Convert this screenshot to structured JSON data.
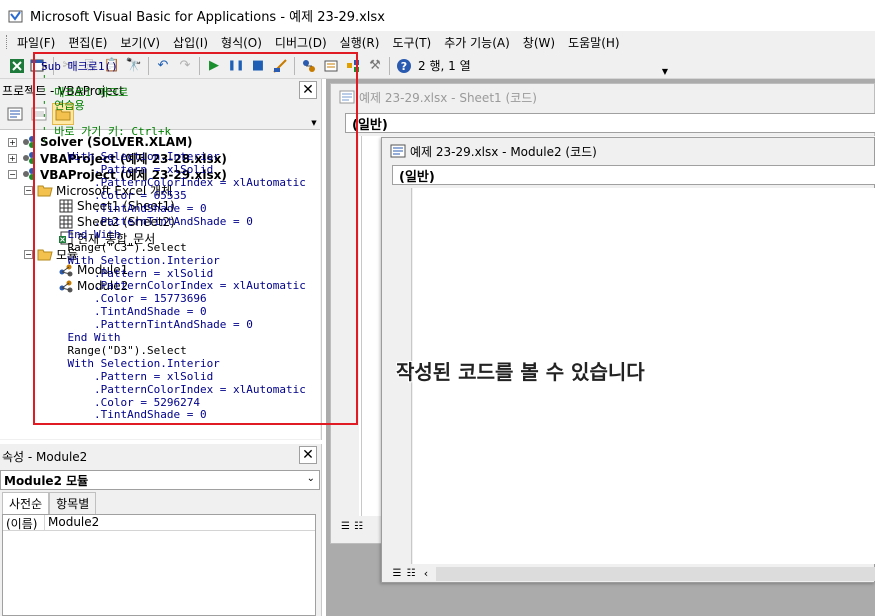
{
  "window": {
    "title": "Microsoft Visual Basic for Applications - 예제 23-29.xlsx"
  },
  "menu": [
    "파일(F)",
    "편집(E)",
    "보기(V)",
    "삽입(I)",
    "형식(O)",
    "디버그(D)",
    "실행(R)",
    "도구(T)",
    "추가 기능(A)",
    "창(W)",
    "도움말(H)"
  ],
  "toolbar": {
    "position": "2 행, 1 열"
  },
  "project": {
    "title": "프로젝트 - VBAProject",
    "nodes": [
      "Solver (SOLVER.XLAM)",
      "VBAProject (예제 23-28.xlsx)",
      "VBAProject (예제 23-29.xlsx)",
      "Microsoft Excel 개체",
      "Sheet1 (Sheet1)",
      "Sheet2 (Sheet2)",
      "현재_통합_문서",
      "모듈",
      "Module1",
      "Module2"
    ]
  },
  "properties": {
    "title": "속성 - Module2",
    "selector": "Module2 모듈",
    "tabs": [
      "사전순",
      "항목별"
    ],
    "row_name": "(이름)",
    "row_value": "Module2"
  },
  "code_windows": {
    "back": {
      "title": "예제 23-29.xlsx - Sheet1 (코드)",
      "combo": "(일반)"
    },
    "front": {
      "title": "예제 23-29.xlsx - Module2 (코드)",
      "combo": "(일반)"
    }
  },
  "code": [
    {
      "t": "Sub 매크로1()",
      "c": "kw"
    },
    {
      "t": "'",
      "c": "cm"
    },
    {
      "t": "' 매크로1 매크로",
      "c": "cm"
    },
    {
      "t": "' 연습용",
      "c": "cm"
    },
    {
      "t": "'",
      "c": "cm"
    },
    {
      "t": "' 바로 가기 키: Ctrl+k",
      "c": "cm"
    },
    {
      "t": "'",
      "c": "cm"
    },
    {
      "t": "    With Selection.Interior",
      "c": "kw"
    },
    {
      "t": "        .Pattern = xlSolid",
      "c": "kw"
    },
    {
      "t": "        .PatternColorIndex = xlAutomatic",
      "c": "kw"
    },
    {
      "t": "        .Color = 65535",
      "c": "kw"
    },
    {
      "t": "        .TintAndShade = 0",
      "c": "kw"
    },
    {
      "t": "        .PatternTintAndShade = 0",
      "c": "kw"
    },
    {
      "t": "    End With",
      "c": "kw"
    },
    {
      "t": "    Range(\"C3\").Select",
      "c": ""
    },
    {
      "t": "    With Selection.Interior",
      "c": "kw"
    },
    {
      "t": "        .Pattern = xlSolid",
      "c": "kw"
    },
    {
      "t": "        .PatternColorIndex = xlAutomatic",
      "c": "kw"
    },
    {
      "t": "        .Color = 15773696",
      "c": "kw"
    },
    {
      "t": "        .TintAndShade = 0",
      "c": "kw"
    },
    {
      "t": "        .PatternTintAndShade = 0",
      "c": "kw"
    },
    {
      "t": "    End With",
      "c": "kw"
    },
    {
      "t": "    Range(\"D3\").Select",
      "c": ""
    },
    {
      "t": "    With Selection.Interior",
      "c": "kw"
    },
    {
      "t": "        .Pattern = xlSolid",
      "c": "kw"
    },
    {
      "t": "        .PatternColorIndex = xlAutomatic",
      "c": "kw"
    },
    {
      "t": "        .Color = 5296274",
      "c": "kw"
    },
    {
      "t": "        .TintAndShade = 0",
      "c": "kw"
    }
  ],
  "overlay_text": "작성된 코드를 볼 수 있습니다",
  "colors": {
    "highlight_border": "#e01b24",
    "keyword": "#00008b",
    "comment": "#008000"
  }
}
